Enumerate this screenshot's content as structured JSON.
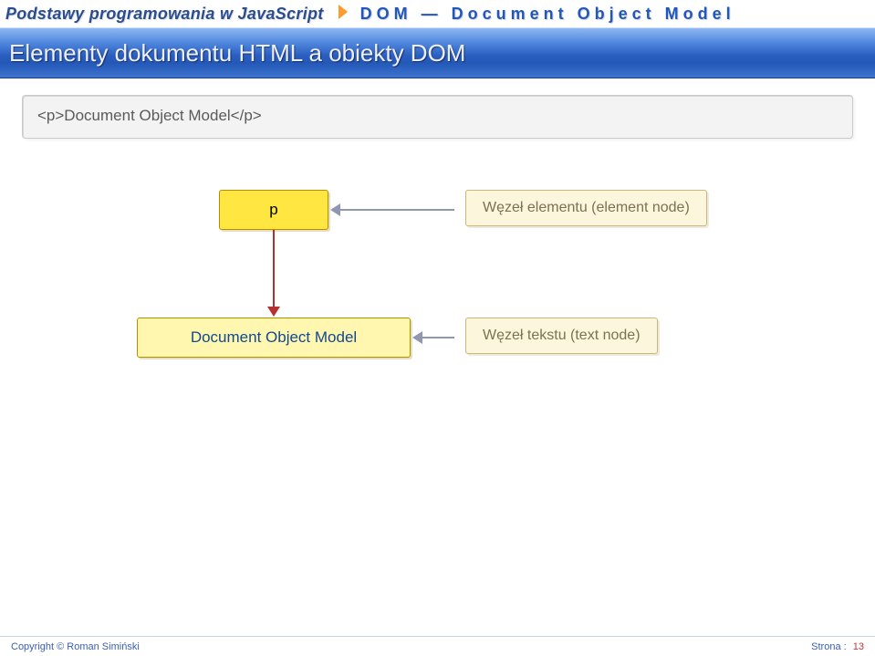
{
  "header": {
    "course": "Podstawy programowania w JavaScript",
    "topic": "DOM — Document Object Model"
  },
  "banner": {
    "title": "Elementy dokumentu HTML a obiekty DOM"
  },
  "snippet": {
    "code": "<p>Document Object Model</p>"
  },
  "diagram": {
    "node_p": "p",
    "node_doc": "Document Object Model",
    "label_element": "Węzeł elementu (element node)",
    "label_text": "Węzeł tekstu (text node)"
  },
  "footer": {
    "copyright": "Copyright © Roman Simiński",
    "page_label": "Strona :",
    "page_number": "13"
  }
}
